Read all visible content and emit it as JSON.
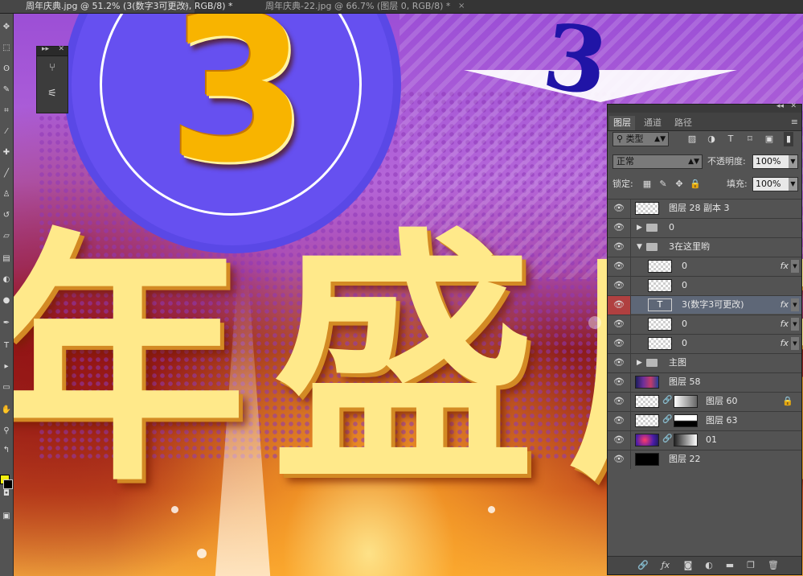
{
  "tabs": [
    {
      "title": "周年庆典.jpg @ 51.2% (3(数字3可更改), RGB/8) *",
      "close": "×"
    },
    {
      "title": "周年庆典-22.jpg @ 66.7% (图层 0, RGB/8) *",
      "close": "×"
    }
  ],
  "colors": {
    "foreground": "#f4ef10",
    "background": "#000000",
    "selected_layer": "#5e6777"
  },
  "canvas": {
    "badge_number": "3",
    "blue_number": "3",
    "title_chars": [
      "年",
      "盛",
      "店"
    ]
  },
  "layers_panel": {
    "tabs": [
      "图层",
      "通道",
      "路径"
    ],
    "filter": {
      "label": "类型"
    },
    "blend_mode": "正常",
    "opacity_label": "不透明度:",
    "opacity_value": "100%",
    "lock_label": "锁定:",
    "fill_label": "填充:",
    "fill_value": "100%",
    "layers": [
      {
        "name": "图层 28 副本 3",
        "type": "image"
      },
      {
        "name": "0",
        "type": "group",
        "expanded": false
      },
      {
        "name": "3在这里哟",
        "type": "group",
        "expanded": true
      },
      {
        "name": "0",
        "type": "layer",
        "fx": "fx"
      },
      {
        "name": "0",
        "type": "layer"
      },
      {
        "name": "3(数字3可更改)",
        "type": "text",
        "fx": "fx",
        "selected": true
      },
      {
        "name": "0",
        "type": "layer",
        "fx": "fx"
      },
      {
        "name": "0",
        "type": "layer",
        "fx": "fx"
      },
      {
        "name": "主图",
        "type": "group",
        "expanded": false
      },
      {
        "name": "图层 58",
        "type": "image"
      },
      {
        "name": "图层 60",
        "type": "masked",
        "locked": true
      },
      {
        "name": "图层 63",
        "type": "masked"
      },
      {
        "name": "01",
        "type": "masked"
      },
      {
        "name": "图层 22",
        "type": "solid"
      }
    ]
  }
}
